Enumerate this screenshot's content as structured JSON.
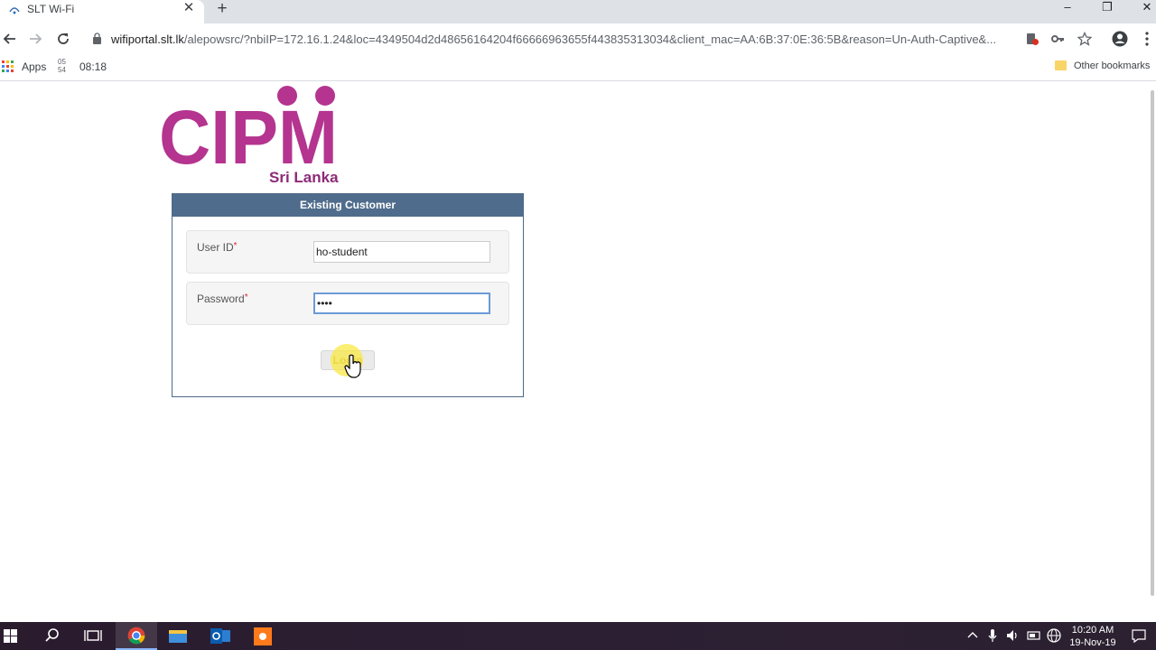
{
  "browser": {
    "tab_title": "SLT Wi-Fi",
    "tab_close_glyph": "✕",
    "new_tab_glyph": "+",
    "url_host": "wifiportal.slt.lk",
    "url_rest": "/alepowsrc/?nbiIP=172.16.1.24&loc=4349504d2d48656164204f66666963655f443835313034&client_mac=AA:6B:37:0E:36:5B&reason=Un-Auth-Captive&...",
    "window_controls": {
      "minimize": "–",
      "restore": "❐",
      "close": "✕"
    }
  },
  "bookmarks": {
    "apps_label": "Apps",
    "clock_icon_text": "05 54",
    "clock_label": "08:18",
    "other_bookmarks_label": "Other bookmarks"
  },
  "page": {
    "logo_text": "CIPM",
    "logo_subtitle": "Sri Lanka",
    "panel_title": "Existing Customer",
    "user_id_label": "User ID",
    "user_id_required": "*",
    "user_id_value": "ho-student",
    "password_label": "Password",
    "password_required": "*",
    "password_value": "••••",
    "login_label": "Login"
  },
  "taskbar": {
    "time": "10:20 AM",
    "date": "19-Nov-19"
  },
  "colors": {
    "logo_magenta": "#b4348f",
    "panel_header": "#506c8c",
    "required_star": "#d9263d",
    "focus_border": "#6c9bd8"
  }
}
